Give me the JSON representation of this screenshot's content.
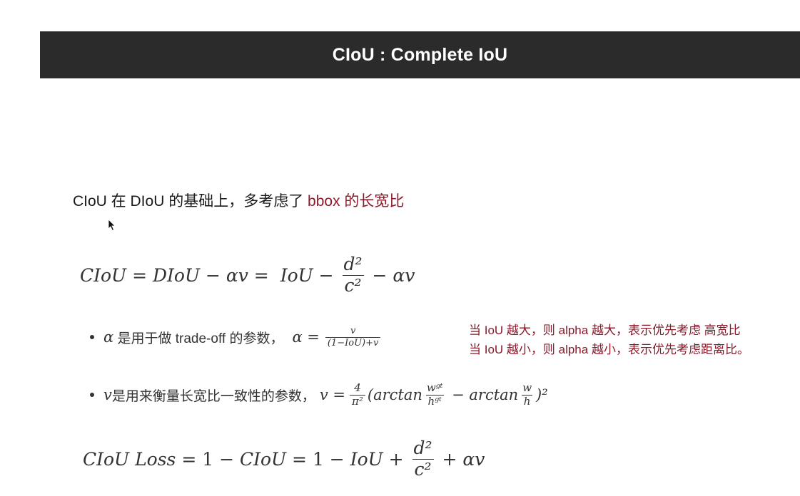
{
  "title": "CIoU : Complete IoU",
  "intro": {
    "text": "CIoU 在 DIoU 的基础上，多考虑了 ",
    "highlight": "bbox 的长宽比"
  },
  "eq1": {
    "lhs": "CIoU",
    "eq": " = ",
    "diou": "DIoU",
    "minus_alpha_v": " − αv = ",
    "iou": "IoU",
    "minus": " − ",
    "frac_num": "d²",
    "frac_den": "c²",
    "tail": " − αv"
  },
  "bullet1": {
    "symbol": "α",
    "text": " 是用于做 trade-off 的参数，",
    "lhs": "α =",
    "frac_num": "v",
    "frac_den": "(1−IoU)+v"
  },
  "bullet2": {
    "symbol": "v",
    "text": "是用来衡量长宽比一致性的参数，",
    "lhs": "v =",
    "frac_num": "4",
    "frac_den": "π²",
    "open": "(arctan",
    "wgt_num": "wᵍᵗ",
    "wgt_den": "hᵍᵗ",
    "mid": " − arctan",
    "w_num": "w",
    "w_den": "h",
    "close": ")²"
  },
  "note": {
    "line1": "当 IoU 越大，则 alpha 越大，表示优先考虑 高宽比",
    "line2": "当 IoU 越小，则 alpha 越小，表示优先考虑距离比。"
  },
  "eq_final": {
    "lhs": "CIoU Loss",
    "eq": " = 1 − ",
    "ciou": "CIoU",
    "eq2": " = 1 − ",
    "iou": "IoU",
    "plus": " + ",
    "frac_num": "d²",
    "frac_den": "c²",
    "tail": " + αv"
  },
  "colors": {
    "title_bar": "#2b2b2b",
    "accent": "#8a1a2b"
  },
  "icons": {
    "cursor": "mouse-pointer-icon"
  }
}
